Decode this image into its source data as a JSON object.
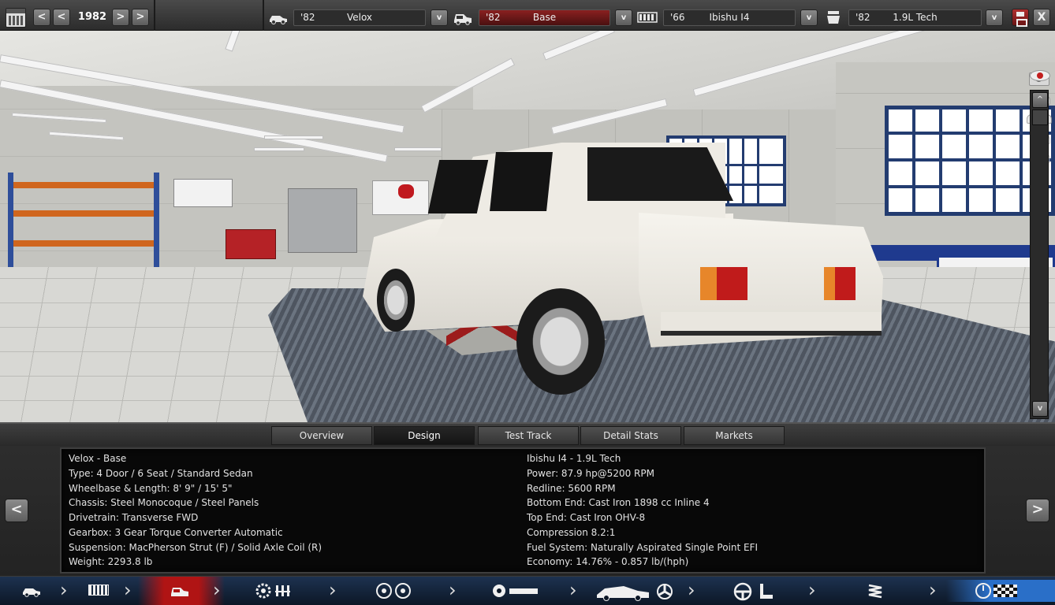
{
  "toolbar": {
    "year": "1982",
    "prev_fast": "<",
    "prev": "<",
    "next": ">",
    "next_fast": ">",
    "dropdown_glyph": "v",
    "close_glyph": "X",
    "model": {
      "year": "'82",
      "name": "Velox"
    },
    "trim": {
      "year": "'82",
      "name": "Base"
    },
    "engine": {
      "year": "'66",
      "name": "Ibishu I4"
    },
    "variant": {
      "year": "'82",
      "name": "1.9L Tech"
    }
  },
  "viewport": {
    "scroll_up": "^",
    "scroll_down": "v",
    "disable_glyph": "✕"
  },
  "tabs": [
    "Overview",
    "Design",
    "Test Track",
    "Detail Stats",
    "Markets"
  ],
  "active_tab": "Design",
  "stats_left": [
    "Velox - Base",
    "Type: 4 Door / 6 Seat / Standard Sedan",
    "Wheelbase & Length: 8' 9\" / 15' 5\"",
    "Chassis: Steel Monocoque / Steel Panels",
    "Drivetrain: Transverse FWD",
    "Gearbox: 3 Gear Torque Converter Automatic",
    "Suspension: MacPherson Strut (F) / Solid Axle Coil (R)",
    "Weight: 2293.8 lb"
  ],
  "stats_right": [
    "Ibishu I4 - 1.9L Tech",
    "Power: 87.9 hp@5200 RPM",
    "Redline: 5600 RPM",
    "Bottom End: Cast Iron 1898 cc Inline 4",
    "Top End: Cast Iron OHV-8",
    "Compression 8.2:1",
    "Fuel System: Naturally Aspirated Single Point EFI",
    "Economy: 14.76% - 0.857 lb/(hph)"
  ],
  "panel_nav": {
    "prev": "<",
    "next": ">"
  },
  "bottom_nav": {
    "steps": [
      "car-model",
      "chassis",
      "trim-body",
      "engine-block",
      "wheels",
      "car-body-fan",
      "interior",
      "suspension",
      "testing"
    ],
    "active_step": "trim-body",
    "chevron": "›",
    "accent_color": "#b01414"
  }
}
